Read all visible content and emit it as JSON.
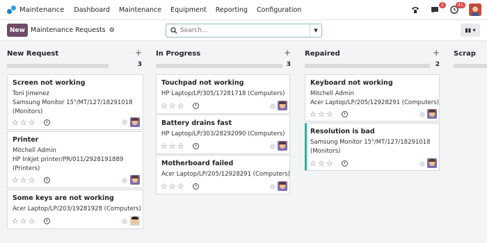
{
  "navbar": {
    "app_name": "Maintenance",
    "menu": [
      "Dashboard",
      "Maintenance",
      "Equipment",
      "Reporting",
      "Configuration"
    ],
    "messages_badge": "2",
    "activities_badge": "41"
  },
  "control": {
    "new_label": "New",
    "breadcrumb": "Maintenance Requests",
    "search_placeholder": "Search..."
  },
  "columns": [
    {
      "title": "New Request",
      "count": "3",
      "cards": [
        {
          "title": "Screen not working",
          "lines": [
            "Toni Jimenez",
            "Samsung Monitor 15\"/MT/127/18291018",
            "(Monitors)"
          ]
        },
        {
          "title": "Printer",
          "lines": [
            "Mitchell Admin",
            "HP Inkjet printer/PR/011/2928191889",
            "(Printers)"
          ]
        },
        {
          "title": "Some keys are not working",
          "lines": [
            "Acer Laptop/LP/203/19281928 (Computers)"
          ]
        }
      ]
    },
    {
      "title": "In Progress",
      "count": "3",
      "cards": [
        {
          "title": "Touchpad not working",
          "lines": [
            "HP Laptop/LP/305/17281718 (Computers)"
          ]
        },
        {
          "title": "Battery drains fast",
          "lines": [
            "HP Laptop/LP/303/28292090 (Computers)"
          ]
        },
        {
          "title": "Motherboard failed",
          "lines": [
            "Acer Laptop/LP/205/12928291 (Computers)"
          ]
        }
      ]
    },
    {
      "title": "Repaired",
      "count": "2",
      "cards": [
        {
          "title": "Keyboard not working",
          "lines": [
            "Mitchell Admin",
            "Acer Laptop/LP/205/12928291 (Computers)"
          ]
        },
        {
          "title": "Resolution is bad",
          "lines": [
            "Samsung Monitor 15\"/MT/127/18291018",
            "(Monitors)"
          ]
        }
      ]
    },
    {
      "title": "Scrap",
      "count": "",
      "cards": []
    }
  ],
  "colors": {
    "brand": "#714b67",
    "accent": "#21b799",
    "badge": "#e0484a"
  }
}
